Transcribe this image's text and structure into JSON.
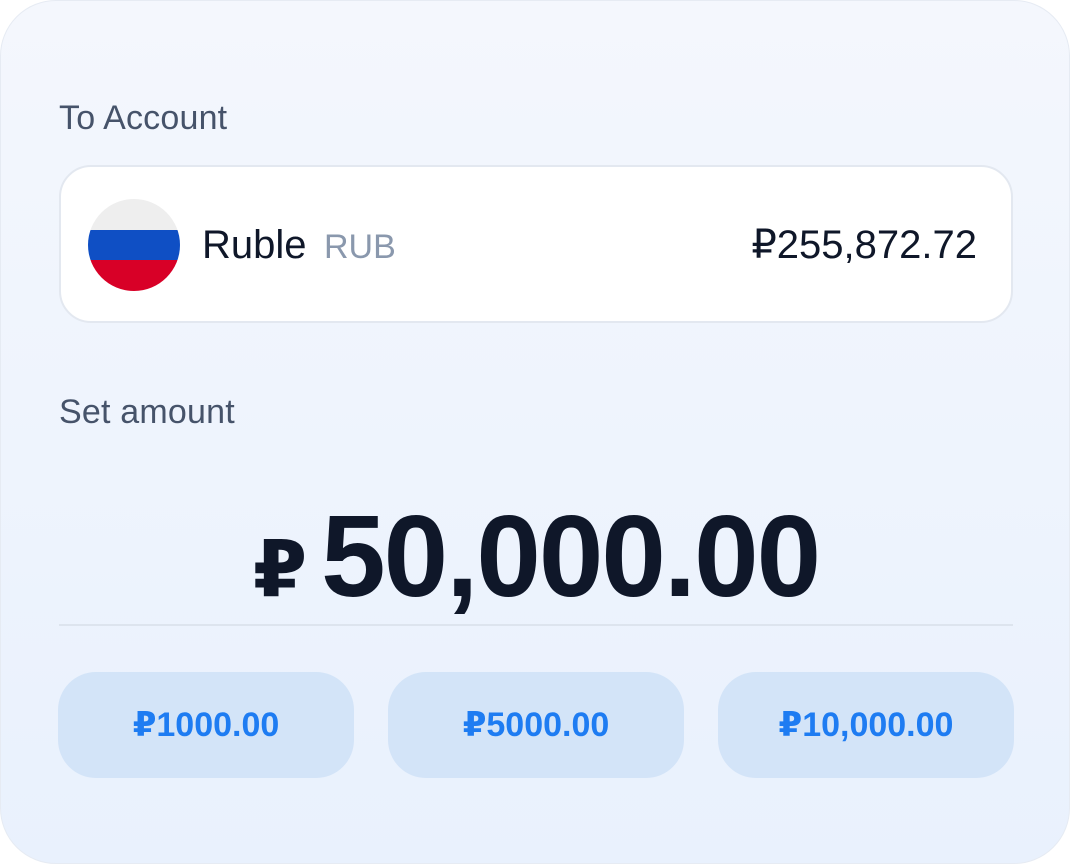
{
  "to_account": {
    "label": "To Account",
    "currency_name": "Ruble",
    "currency_code": "RUB",
    "balance": "₽255,872.72",
    "flag_icon": "russia-flag-icon"
  },
  "amount": {
    "label": "Set amount",
    "symbol": "₽",
    "value": "50,000.00"
  },
  "presets": [
    {
      "label": "₽1000.00"
    },
    {
      "label": "₽5000.00"
    },
    {
      "label": "₽10,000.00"
    }
  ],
  "colors": {
    "accent": "#1e7cf2",
    "preset_bg": "#d3e4f8",
    "text_primary": "#0f1729",
    "text_muted": "#8a98ad"
  }
}
